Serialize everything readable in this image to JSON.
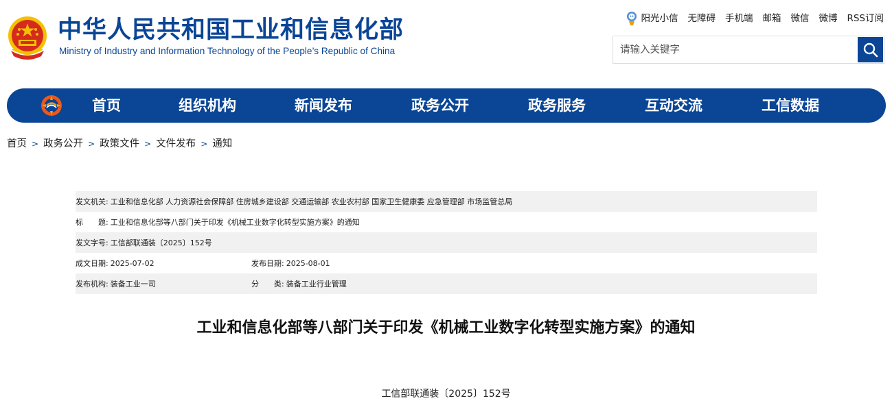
{
  "header": {
    "title": "中华人民共和国工业和信息化部",
    "subtitle": "Ministry of Industry and Information Technology of the People’s Republic of China",
    "links": [
      "阳光小信",
      "无障碍",
      "手机端",
      "邮箱",
      "微信",
      "微博",
      "RSS订阅"
    ]
  },
  "search": {
    "placeholder": "请输入关键字",
    "value": ""
  },
  "nav": {
    "items": [
      "首页",
      "组织机构",
      "新闻发布",
      "政务公开",
      "政务服务",
      "互动交流",
      "工信数据"
    ]
  },
  "breadcrumb": [
    "首页",
    "政务公开",
    "政策文件",
    "文件发布",
    "通知"
  ],
  "meta": {
    "issuer_label": "发文机关:",
    "issuer_value": "工业和信息化部 人力资源社会保障部 住房城乡建设部 交通运输部 农业农村部 国家卫生健康委 应急管理部 市场监管总局",
    "title_label": "标　　题:",
    "title_value": "工业和信息化部等八部门关于印发《机械工业数字化转型实施方案》的通知",
    "docno_label": "发文字号:",
    "docno_value": "工信部联通装〔2025〕152号",
    "created_label": "成文日期:",
    "created_value": "2025-07-02",
    "published_label": "发布日期:",
    "published_value": "2025-08-01",
    "org_label": "发布机构:",
    "org_value": "装备工业一司",
    "category_label": "分　　类:",
    "category_value": "装备工业行业管理"
  },
  "document": {
    "title": "工业和信息化部等八部门关于印发《机械工业数字化转型实施方案》的通知",
    "number": "工信部联通装〔2025〕152号"
  },
  "colors": {
    "brand_blue": "#0a4596",
    "emblem_red": "#d52b1e",
    "emblem_gold": "#f5c000",
    "row_shade": "#f1f1f1"
  },
  "icons": [
    "national-emblem-icon",
    "sunshine-mascot-icon",
    "search-icon",
    "miit-logo-icon",
    "chevron-right-icon"
  ]
}
